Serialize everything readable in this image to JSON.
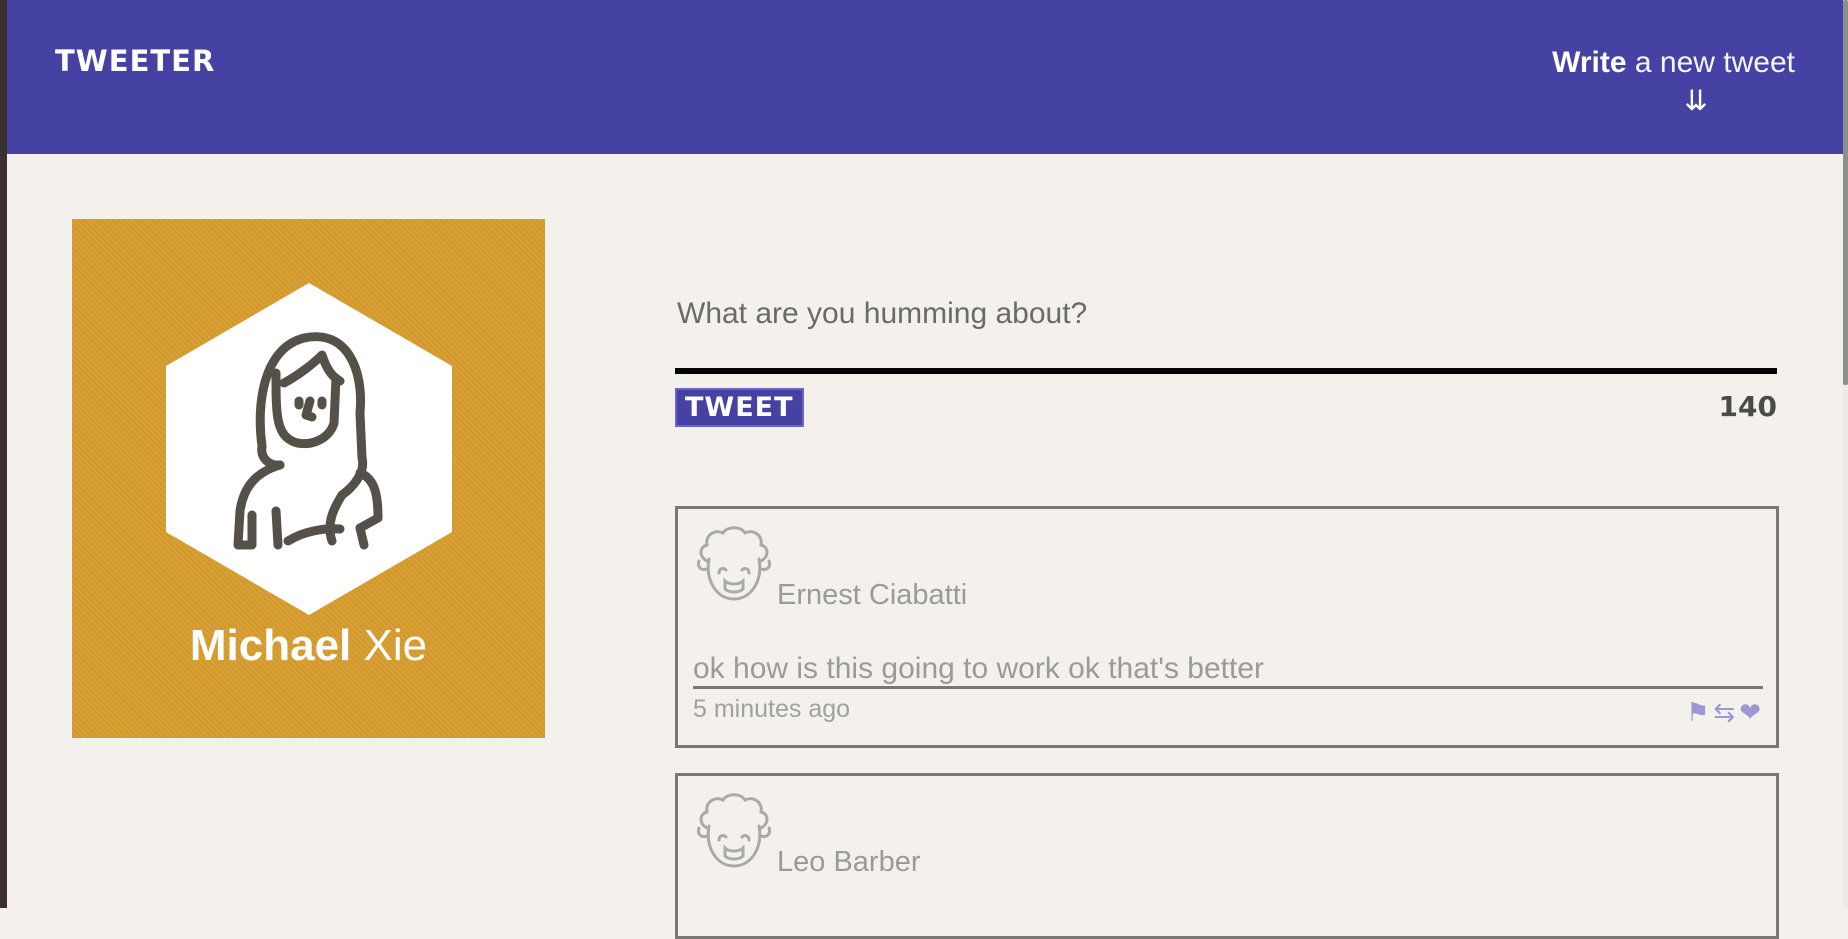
{
  "header": {
    "brand": "TWEETER",
    "compose_bold": "Write",
    "compose_rest": " a new tweet",
    "compose_arrow": "⇊"
  },
  "profile": {
    "first_name": "Michael",
    "last_name": " Xie"
  },
  "composer": {
    "placeholder": "What are you humming about?",
    "button_label": "TWEET",
    "counter": "140"
  },
  "tweets": [
    {
      "author": "Ernest Ciabatti",
      "text": "ok how is this going to work ok that's better",
      "time": "5 minutes ago"
    },
    {
      "author": "Leo Barber"
    }
  ],
  "icons": {
    "flag": "⚑",
    "retweet": "⇆",
    "like": "❤"
  },
  "colors": {
    "header_bg": "#4642a3",
    "profile_bg": "#d89e2e",
    "page_bg": "#f4f1ec",
    "action_icons": "#9b98d4"
  }
}
